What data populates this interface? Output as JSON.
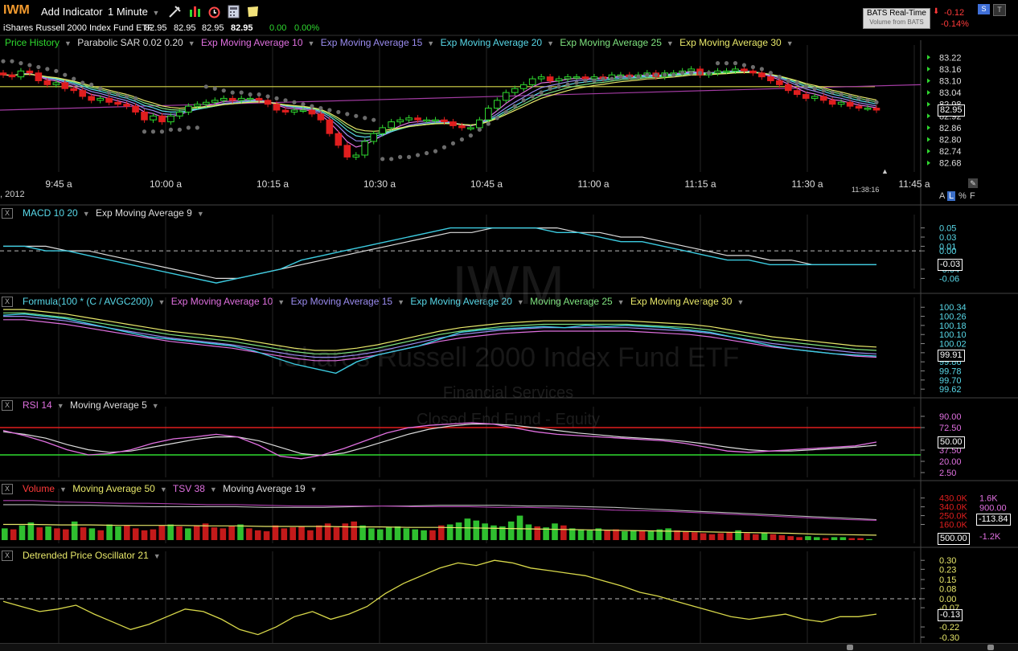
{
  "toolbar": {
    "ticker": "IWM",
    "add_indicator": "Add Indicator",
    "interval": "1 Minute",
    "security_name": "iShares Russell 2000 Index Fund ETF",
    "open": "82.95",
    "high": "82.95",
    "low": "82.95",
    "last": "82.95",
    "change": "0.00",
    "change_pct": "0.00%",
    "bats_title": "BATS Real-Time",
    "bats_sub": "Volume from BATS",
    "day_change": "-0.12",
    "day_change_pct": "-0.14%"
  },
  "watermark": {
    "symbol": "IWM",
    "name": "iShares Russell 2000 Index Fund ETF",
    "sector": "Financial Services",
    "industry": "Closed End Fund - Equity"
  },
  "price_panel": {
    "legend": [
      {
        "label": "Price History",
        "color": "#2fd92f"
      },
      {
        "label": "Parabolic SAR 0.02 0.20",
        "color": "#dddddd"
      },
      {
        "label": "Exp Moving Average 10",
        "color": "#e070e0"
      },
      {
        "label": "Exp Moving Average 15",
        "color": "#9b8cf0"
      },
      {
        "label": "Exp Moving Average 20",
        "color": "#58d8e8"
      },
      {
        "label": "Exp Moving Average 25",
        "color": "#7fe37f"
      },
      {
        "label": "Exp Moving Average 30",
        "color": "#e8e86a"
      }
    ],
    "current_value": "82.95",
    "date_fragment": ", 2012",
    "time_readout": "11:38:16",
    "alf": [
      "A",
      "L",
      "%",
      "F"
    ]
  },
  "macd_panel": {
    "legend": [
      {
        "label": "MACD 10 20",
        "color": "#58d8e8"
      },
      {
        "label": "Exp Moving Average 9",
        "color": "#dddddd"
      }
    ],
    "current_value": "-0.03"
  },
  "formula_panel": {
    "legend": [
      {
        "label": "Formula(100 * (C / AVGC200))",
        "color": "#58d8e8"
      },
      {
        "label": "Exp Moving Average 10",
        "color": "#e070e0"
      },
      {
        "label": "Exp Moving Average 15",
        "color": "#9b8cf0"
      },
      {
        "label": "Exp Moving Average 20",
        "color": "#58d8e8"
      },
      {
        "label": "Moving Average 25",
        "color": "#7fe37f"
      },
      {
        "label": "Exp Moving Average 30",
        "color": "#e8e86a"
      }
    ],
    "current_value": "99.91"
  },
  "rsi_panel": {
    "legend": [
      {
        "label": "RSI 14",
        "color": "#e070e0"
      },
      {
        "label": "Moving Average 5",
        "color": "#dddddd"
      }
    ],
    "current_value": "50.00"
  },
  "volume_panel": {
    "legend": [
      {
        "label": "Volume",
        "color": "#ff3a3a"
      },
      {
        "label": "Moving Average 50",
        "color": "#e8e86a"
      },
      {
        "label": "TSV 38",
        "color": "#e070e0"
      },
      {
        "label": "Moving Average 19",
        "color": "#dddddd"
      }
    ],
    "current_value": "-113.84",
    "current_volume": "500.00"
  },
  "dpo_panel": {
    "legend": [
      {
        "label": "Detrended Price Oscillator 21",
        "color": "#e8e86a"
      }
    ],
    "current_value": "-0.13"
  },
  "chart_data": [
    {
      "type": "candlestick",
      "title": "iShares Russell 2000 Index Fund ETF",
      "x_ticks": [
        "9:45 a",
        "10:00 a",
        "10:15 a",
        "10:30 a",
        "10:45 a",
        "11:00 a",
        "11:15 a",
        "11:30 a",
        "11:45 a"
      ],
      "y_ticks": [
        "83.22",
        "83.16",
        "83.10",
        "83.04",
        "82.98",
        "82.92",
        "82.86",
        "82.80",
        "82.74",
        "82.68"
      ],
      "ylim": [
        82.65,
        83.25
      ],
      "close": [
        83.13,
        83.12,
        83.15,
        83.14,
        83.1,
        83.08,
        83.09,
        83.06,
        83.05,
        83.02,
        83.0,
        83.01,
        82.99,
        82.98,
        82.97,
        82.94,
        82.9,
        82.92,
        82.89,
        82.92,
        82.94,
        82.97,
        82.98,
        82.99,
        83.0,
        83.01,
        83.0,
        83.01,
        83.01,
        83.0,
        82.98,
        82.95,
        82.94,
        82.95,
        82.95,
        82.93,
        82.9,
        82.83,
        82.77,
        82.71,
        82.72,
        82.79,
        82.83,
        82.86,
        82.89,
        82.9,
        82.91,
        82.9,
        82.9,
        82.9,
        82.89,
        82.87,
        82.86,
        82.86,
        82.9,
        82.96,
        83.0,
        83.04,
        83.06,
        83.08,
        83.11,
        83.12,
        83.1,
        83.11,
        83.12,
        83.12,
        83.11,
        83.12,
        83.11,
        83.13,
        83.13,
        83.12,
        83.13,
        83.14,
        83.12,
        83.14,
        83.14,
        83.15,
        83.16,
        83.13,
        83.14,
        83.15,
        83.15,
        83.16,
        83.15,
        83.14,
        83.12,
        83.1,
        83.08,
        83.05,
        83.03,
        83.01,
        83.02,
        83.0,
        82.98,
        82.99,
        82.97,
        82.96,
        82.96,
        82.95
      ],
      "sar": [
        83.2,
        83.2,
        83.19,
        83.18,
        83.17,
        83.16,
        83.15,
        83.13,
        83.11,
        83.09,
        83.08,
        83.06,
        83.04,
        83.03,
        83.02,
        83.01,
        82.84,
        82.84,
        82.84,
        82.85,
        82.85,
        82.86,
        82.86,
        83.07,
        83.06,
        83.05,
        83.04,
        83.04,
        83.03,
        83.03,
        83.02,
        83.01,
        83.0,
        82.99,
        82.98,
        82.97,
        82.96,
        82.95,
        82.94,
        82.93,
        82.92,
        82.91,
        82.9,
        82.7,
        82.7,
        82.71,
        82.71,
        82.72,
        82.73,
        82.74,
        82.76,
        82.78,
        82.8,
        82.82,
        82.85,
        82.88,
        82.91,
        82.94,
        82.97,
        83.0,
        83.02,
        83.04,
        83.06,
        83.07,
        83.08,
        83.09,
        83.1,
        83.1,
        83.11,
        83.11,
        83.12,
        83.12,
        83.12,
        83.13,
        83.13,
        83.13,
        83.13,
        83.14,
        83.14,
        83.14,
        83.14,
        83.19,
        83.19,
        83.19,
        83.18,
        83.17,
        83.16,
        83.14,
        83.12,
        83.1,
        83.09,
        83.07,
        83.06,
        83.05,
        83.04,
        83.03,
        83.02,
        83.01,
        83.0,
        82.99
      ],
      "ema_levels": [
        83.0,
        83.02,
        83.04,
        83.06,
        83.08
      ],
      "hline": 83.07
    },
    {
      "type": "line",
      "title": "MACD 10 20",
      "y_ticks": [
        "0.05",
        "0.03",
        "0.01",
        "0.00",
        "-0.04",
        "-0.06"
      ],
      "ylim": [
        -0.075,
        0.065
      ],
      "macd": [
        0.01,
        0.01,
        0.0,
        0.0,
        -0.01,
        -0.02,
        -0.03,
        -0.04,
        -0.05,
        -0.06,
        -0.07,
        -0.06,
        -0.05,
        -0.04,
        -0.02,
        -0.01,
        0.0,
        0.01,
        0.02,
        0.03,
        0.04,
        0.05,
        0.05,
        0.05,
        0.05,
        0.05,
        0.04,
        0.04,
        0.03,
        0.02,
        0.02,
        0.01,
        0.0,
        -0.01,
        -0.02,
        -0.02,
        -0.03,
        -0.03,
        -0.03,
        -0.03,
        -0.03,
        -0.03
      ],
      "signal": [
        0.01,
        0.01,
        0.01,
        0.0,
        0.0,
        -0.01,
        -0.02,
        -0.03,
        -0.04,
        -0.05,
        -0.06,
        -0.06,
        -0.05,
        -0.04,
        -0.03,
        -0.02,
        -0.01,
        0.0,
        0.01,
        0.02,
        0.03,
        0.04,
        0.04,
        0.05,
        0.05,
        0.05,
        0.05,
        0.04,
        0.04,
        0.03,
        0.03,
        0.02,
        0.01,
        0.0,
        -0.01,
        -0.01,
        -0.02,
        -0.02,
        -0.03,
        -0.03,
        -0.03,
        -0.03
      ]
    },
    {
      "type": "line",
      "title": "Formula(100 * (C / AVGC200))",
      "y_ticks": [
        "100.34",
        "100.26",
        "100.18",
        "100.10",
        "100.02",
        "99.94",
        "99.86",
        "99.78",
        "99.70",
        "99.62"
      ],
      "ylim": [
        99.6,
        100.37
      ],
      "formula": [
        100.27,
        100.28,
        100.26,
        100.24,
        100.2,
        100.16,
        100.12,
        100.08,
        100.06,
        100.04,
        100.02,
        100.0,
        99.96,
        99.9,
        99.84,
        99.8,
        99.76,
        99.86,
        99.92,
        99.96,
        100.0,
        100.06,
        100.12,
        100.14,
        100.15,
        100.16,
        100.17,
        100.16,
        100.18,
        100.17,
        100.18,
        100.17,
        100.16,
        100.14,
        100.12,
        100.08,
        100.04,
        100.0,
        99.97,
        99.95,
        99.93,
        99.92,
        99.91
      ],
      "ema": [
        100.26,
        100.26,
        100.24,
        100.22,
        100.19,
        100.16,
        100.13,
        100.1,
        100.07,
        100.05,
        100.03,
        100.01,
        99.98,
        99.95,
        99.92,
        99.9,
        99.9,
        99.92,
        99.95,
        99.99,
        100.03,
        100.07,
        100.1,
        100.12,
        100.14,
        100.15,
        100.16,
        100.16,
        100.16,
        100.16,
        100.16,
        100.15,
        100.14,
        100.13,
        100.11,
        100.08,
        100.05,
        100.02,
        100.0,
        99.98,
        99.96,
        99.94,
        99.93
      ]
    },
    {
      "type": "line",
      "title": "RSI 14",
      "y_ticks": [
        "90.00",
        "72.50",
        "37.50",
        "20.00",
        "2.50"
      ],
      "ylim": [
        0,
        95
      ],
      "upper": 72.5,
      "lower": 30,
      "rsi": [
        68,
        60,
        50,
        38,
        30,
        32,
        38,
        48,
        55,
        58,
        62,
        58,
        45,
        28,
        24,
        30,
        40,
        52,
        64,
        72,
        76,
        78,
        80,
        78,
        72,
        66,
        62,
        60,
        58,
        56,
        54,
        52,
        48,
        42,
        36,
        34,
        36,
        38,
        40,
        42,
        44,
        50
      ],
      "ma": [
        66,
        62,
        56,
        46,
        38,
        34,
        36,
        42,
        48,
        54,
        58,
        58,
        52,
        42,
        32,
        29,
        33,
        42,
        52,
        62,
        70,
        75,
        78,
        78,
        76,
        72,
        68,
        64,
        61,
        58,
        56,
        54,
        51,
        47,
        42,
        38,
        36,
        36,
        38,
        40,
        42,
        45
      ]
    },
    {
      "type": "bar",
      "title": "Volume",
      "y_ticks": [
        "430.0K",
        "340.0K",
        "250.0K",
        "160.0K"
      ],
      "ylim": [
        0,
        460000
      ],
      "tsv_ticks": [
        "1.6K",
        "900.00",
        "-1.2K"
      ],
      "up": [
        1,
        0,
        1,
        1,
        0,
        1,
        0,
        0,
        1,
        0,
        1,
        0,
        1,
        1,
        0,
        0,
        0,
        0,
        0,
        1,
        0,
        1,
        0,
        0,
        0,
        0,
        0,
        1,
        0,
        0,
        0,
        0,
        0,
        0,
        0,
        0,
        0,
        0,
        0,
        0,
        0,
        1,
        1,
        1,
        1,
        1,
        1,
        1,
        1,
        0,
        0,
        1,
        1,
        1,
        1,
        1,
        1,
        1,
        1,
        1,
        1,
        0,
        1,
        1,
        0,
        1,
        1,
        1,
        1,
        0,
        0,
        1,
        1,
        0,
        1,
        1,
        1,
        0,
        0,
        0,
        0,
        0,
        0,
        0,
        1,
        0,
        0,
        1,
        0,
        0,
        0,
        0,
        1,
        1,
        0,
        1,
        1,
        0,
        0,
        1
      ],
      "volume": [
        120000,
        110000,
        150000,
        180000,
        130000,
        140000,
        120000,
        110000,
        190000,
        130000,
        120000,
        100000,
        160000,
        140000,
        150000,
        120000,
        100000,
        110000,
        150000,
        160000,
        140000,
        120000,
        150000,
        170000,
        130000,
        120000,
        140000,
        160000,
        120000,
        100000,
        90000,
        150000,
        120000,
        130000,
        140000,
        100000,
        150000,
        170000,
        130000,
        170000,
        190000,
        150000,
        120000,
        110000,
        130000,
        140000,
        120000,
        110000,
        100000,
        100000,
        150000,
        160000,
        180000,
        220000,
        200000,
        170000,
        150000,
        140000,
        190000,
        250000,
        160000,
        140000,
        130000,
        170000,
        150000,
        120000,
        110000,
        100000,
        120000,
        100000,
        110000,
        90000,
        100000,
        100000,
        90000,
        110000,
        120000,
        100000,
        90000,
        80000,
        70000,
        60000,
        70000,
        80000,
        100000,
        70000,
        60000,
        70000,
        60000,
        50000,
        40000,
        30000,
        40000,
        30000,
        20000,
        30000,
        30000,
        20000,
        20000,
        10000
      ],
      "ma50": [
        160000,
        160000,
        155000,
        155000,
        150000,
        150000,
        150000,
        145000,
        145000,
        140000,
        140000,
        140000,
        135000,
        135000,
        130000,
        130000,
        125000,
        120000,
        115000,
        110000,
        105000,
        100000,
        95000,
        90000,
        85000,
        80000,
        75000,
        70000,
        60000,
        55000,
        50000
      ],
      "tsv": [
        1400,
        1400,
        1300,
        1250,
        1200,
        1200,
        1150,
        1100,
        1100,
        1050,
        1000,
        1000,
        1000,
        1000,
        950,
        950,
        950,
        900,
        900,
        850,
        800,
        700,
        650,
        600,
        500,
        400,
        300,
        200,
        100,
        0,
        -50
      ],
      "tsv_ma": [
        1100,
        1100,
        1050,
        1050,
        1000,
        950,
        950,
        950,
        950,
        900,
        900,
        900,
        950,
        1000,
        1000,
        1050,
        1050,
        1050,
        1000,
        1000,
        950,
        900,
        800,
        700,
        600,
        500,
        400,
        300,
        200,
        100,
        0
      ]
    },
    {
      "type": "line",
      "title": "Detrended Price Oscillator 21",
      "y_ticks": [
        "0.30",
        "0.23",
        "0.15",
        "0.08",
        "0.00",
        "-0.07",
        "-0.22",
        "-0.30"
      ],
      "ylim": [
        -0.32,
        0.32
      ],
      "values": [
        -0.02,
        -0.06,
        -0.1,
        -0.08,
        -0.05,
        -0.12,
        -0.18,
        -0.24,
        -0.2,
        -0.14,
        -0.08,
        -0.1,
        -0.16,
        -0.24,
        -0.28,
        -0.22,
        -0.14,
        -0.1,
        -0.16,
        -0.12,
        -0.06,
        0.04,
        0.12,
        0.18,
        0.24,
        0.28,
        0.26,
        0.3,
        0.28,
        0.24,
        0.22,
        0.2,
        0.18,
        0.14,
        0.1,
        0.05,
        0.02,
        -0.02,
        -0.06,
        -0.1,
        -0.14,
        -0.16,
        -0.14,
        -0.12,
        -0.16,
        -0.18,
        -0.14,
        -0.14,
        -0.12
      ]
    }
  ]
}
